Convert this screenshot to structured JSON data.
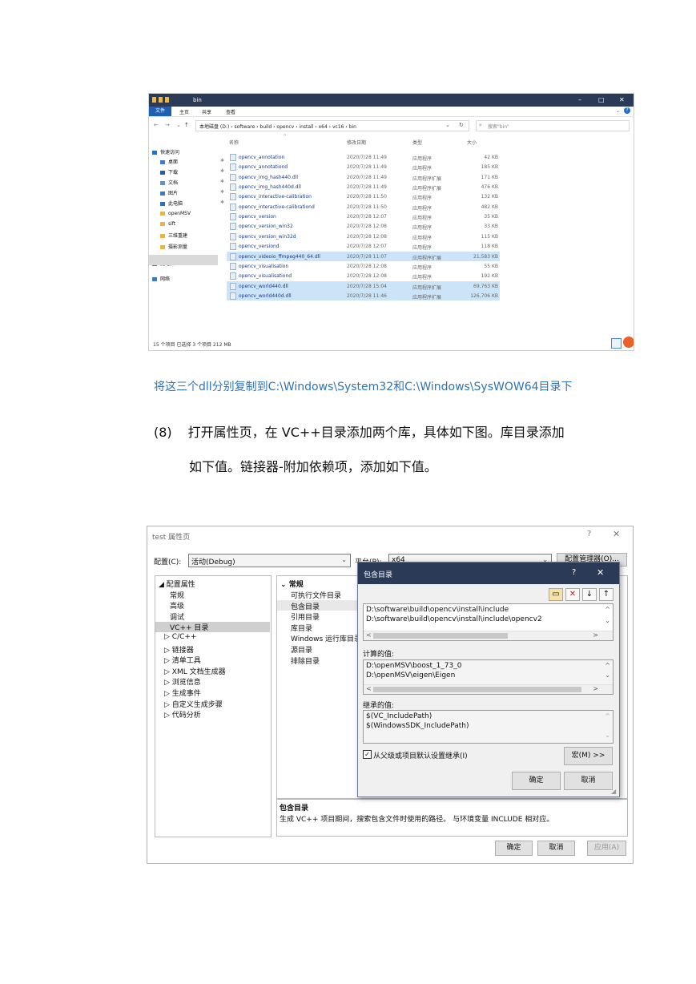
{
  "explorer": {
    "window_title": "bin",
    "ribbon": {
      "file": "文件",
      "home": "主页",
      "share": "共享",
      "view": "查看"
    },
    "breadcrumb": "本地磁盘 (D:)  ›  software  ›  build  ›  opencv  ›  install  ›  x64  ›  vc16  ›  bin",
    "search_placeholder": "搜索\"bin\"",
    "columns": {
      "name": "名称",
      "date": "修改日期",
      "type": "类型",
      "size": "大小"
    },
    "sidebar": [
      {
        "label": "快速访问",
        "pinned": false
      },
      {
        "label": "桌面",
        "pinned": true
      },
      {
        "label": "下载",
        "pinned": true
      },
      {
        "label": "文档",
        "pinned": true
      },
      {
        "label": "图片",
        "pinned": true
      },
      {
        "label": "此电脑",
        "pinned": true
      },
      {
        "label": "openMSV",
        "pinned": false
      },
      {
        "label": "sift",
        "pinned": false
      },
      {
        "label": "三维重建",
        "pinned": false
      },
      {
        "label": "摄影测量",
        "pinned": false
      },
      {
        "label": "此电脑",
        "pinned": false
      },
      {
        "label": "网络",
        "pinned": false
      }
    ],
    "files": [
      {
        "name": "opencv_annotation",
        "date": "2020/7/28 11:49",
        "type": "应用程序",
        "size": "42 KB",
        "selected": false
      },
      {
        "name": "opencv_annotationd",
        "date": "2020/7/28 11:49",
        "type": "应用程序",
        "size": "185 KB",
        "selected": false
      },
      {
        "name": "opencv_img_hash440.dll",
        "date": "2020/7/28 11:49",
        "type": "应用程序扩展",
        "size": "171 KB",
        "selected": false
      },
      {
        "name": "opencv_img_hash440d.dll",
        "date": "2020/7/28 11:49",
        "type": "应用程序扩展",
        "size": "476 KB",
        "selected": false
      },
      {
        "name": "opencv_interactive-calibration",
        "date": "2020/7/28 11:50",
        "type": "应用程序",
        "size": "132 KB",
        "selected": false
      },
      {
        "name": "opencv_interactive-calibrationd",
        "date": "2020/7/28 11:50",
        "type": "应用程序",
        "size": "482 KB",
        "selected": false
      },
      {
        "name": "opencv_version",
        "date": "2020/7/28 12:07",
        "type": "应用程序",
        "size": "35 KB",
        "selected": false
      },
      {
        "name": "opencv_version_win32",
        "date": "2020/7/28 12:08",
        "type": "应用程序",
        "size": "33 KB",
        "selected": false
      },
      {
        "name": "opencv_version_win32d",
        "date": "2020/7/28 12:08",
        "type": "应用程序",
        "size": "115 KB",
        "selected": false
      },
      {
        "name": "opencv_versiond",
        "date": "2020/7/28 12:07",
        "type": "应用程序",
        "size": "118 KB",
        "selected": false
      },
      {
        "name": "opencv_videoio_ffmpeg440_64.dll",
        "date": "2020/7/28 11:07",
        "type": "应用程序扩展",
        "size": "21,583 KB",
        "selected": true
      },
      {
        "name": "opencv_visualisation",
        "date": "2020/7/28 12:08",
        "type": "应用程序",
        "size": "55 KB",
        "selected": false
      },
      {
        "name": "opencv_visualisationd",
        "date": "2020/7/28 12:08",
        "type": "应用程序",
        "size": "192 KB",
        "selected": false
      },
      {
        "name": "opencv_world440.dll",
        "date": "2020/7/28 15:04",
        "type": "应用程序扩展",
        "size": "69,763 KB",
        "selected": true
      },
      {
        "name": "opencv_world440d.dll",
        "date": "2020/7/28 11:46",
        "type": "应用程序扩展",
        "size": "126,706 KB",
        "selected": true
      }
    ],
    "status": "15 个项目    已选择 3 个项目  212 MB"
  },
  "doc": {
    "caption": "将这三个dll分别复制到C:\\Windows\\System32和C:\\Windows\\SysWOW64目录下",
    "step_num": "(8)",
    "step_line1": "打开属性页，在 VC++目录添加两个库，具体如下图。库目录添加",
    "step_line2": "如下值。链接器-附加依赖项，添加如下值。"
  },
  "props": {
    "title": "test 属性页",
    "config_label": "配置(C):",
    "config_value": "活动(Debug)",
    "platform_label": "平台(P):",
    "platform_value": "x64",
    "config_manager": "配置管理器(O)...",
    "tree": [
      {
        "label": "◢ 配置属性",
        "indent": 0
      },
      {
        "label": "常规",
        "indent": 2
      },
      {
        "label": "高级",
        "indent": 2
      },
      {
        "label": "调试",
        "indent": 2
      },
      {
        "label": "VC++ 目录",
        "indent": 2,
        "selected": true
      },
      {
        "label": "▷ C/C++",
        "indent": 1
      },
      {
        "label": "▷ 链接器",
        "indent": 1
      },
      {
        "label": "▷ 清单工具",
        "indent": 1
      },
      {
        "label": "▷ XML 文档生成器",
        "indent": 1
      },
      {
        "label": "▷ 浏览信息",
        "indent": 1
      },
      {
        "label": "▷ 生成事件",
        "indent": 1
      },
      {
        "label": "▷ 自定义生成步骤",
        "indent": 1
      },
      {
        "label": "▷ 代码分析",
        "indent": 1
      }
    ],
    "grid_header": "常规",
    "grid_rows": [
      "可执行文件目录",
      "包含目录",
      "引用目录",
      "库目录",
      "Windows 运行库目录",
      "源目录",
      "排除目录"
    ],
    "desc_title": "包含目录",
    "desc_text": "生成 VC++ 项目期间，搜索包含文件时使用的路径。 与环境变量 INCLUDE 相对应。",
    "ok": "确定",
    "cancel": "取消",
    "apply": "应用(A)"
  },
  "include_dialog": {
    "title": "包含目录",
    "entries": [
      "D:\\software\\build\\opencv\\install\\include",
      "D:\\software\\build\\opencv\\install\\include\\opencv2"
    ],
    "evaluated_label": "计算的值:",
    "evaluated": [
      "D:\\openMSV\\boost_1_73_0",
      "D:\\openMSV\\eigen\\Eigen"
    ],
    "inherited_label": "继承的值:",
    "inherited": [
      "$(VC_IncludePath)",
      "$(WindowsSDK_IncludePath)"
    ],
    "inherit_checkbox": "从父级或项目默认设置继承(I)",
    "macros": "宏(M) >>",
    "ok": "确定",
    "cancel": "取消"
  }
}
